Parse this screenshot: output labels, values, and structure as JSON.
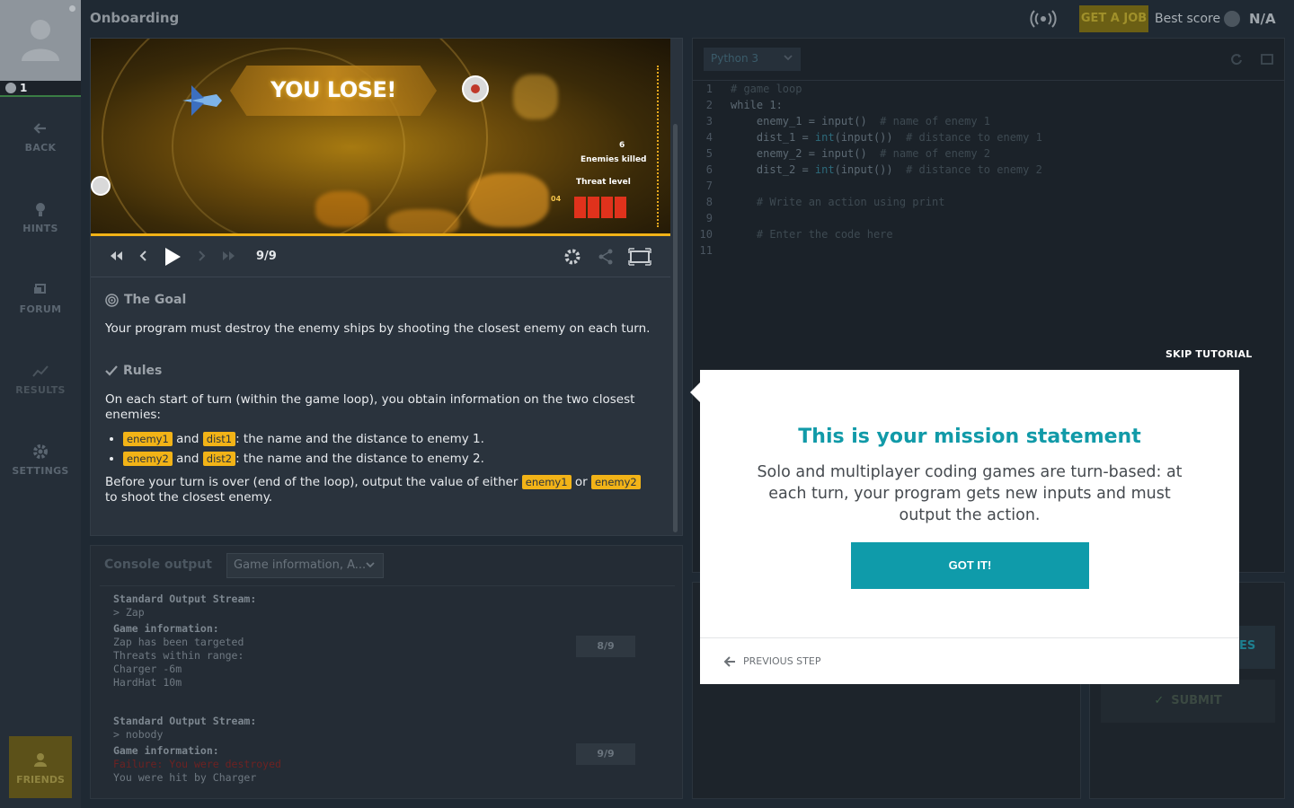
{
  "sidebar": {
    "level": "1",
    "items": [
      {
        "label": "BACK",
        "icon": "arrow-left-icon"
      },
      {
        "label": "HINTS",
        "icon": "lightbulb-icon"
      },
      {
        "label": "FORUM",
        "icon": "forum-icon"
      },
      {
        "label": "RESULTS",
        "icon": "chart-line-icon"
      },
      {
        "label": "SETTINGS",
        "icon": "gear-icon"
      }
    ],
    "friends_label": "FRIENDS"
  },
  "topbar": {
    "title": "Onboarding",
    "get_job": "GET A JOB",
    "best_score_label": "Best score",
    "best_score_value": "N/A"
  },
  "viewer": {
    "banner": "YOU LOSE!",
    "enemies_killed_label": "Enemies killed",
    "enemies_killed_value": "6",
    "threat_label": "Threat level",
    "turn_marker": "04",
    "frame": "9/9",
    "progress": 1.0
  },
  "statement": {
    "goal_title": "The Goal",
    "goal_text": "Your program must destroy the enemy ships by shooting the closest enemy on each turn.",
    "rules_title": "Rules",
    "rules_intro": "On each start of turn (within the game loop), you obtain information on the two closest enemies:",
    "rule1": {
      "tag_a": "enemy1",
      "and": "and",
      "tag_b": "dist1",
      "text": ": the name and the distance to enemy 1."
    },
    "rule2": {
      "tag_a": "enemy2",
      "and": "and",
      "tag_b": "dist2",
      "text": ": the name and the distance to enemy 2."
    },
    "outro_a": "Before your turn is over (end of the loop), output the value of either",
    "outro_tag1": "enemy1",
    "outro_or": "or",
    "outro_tag2": "enemy2",
    "outro_b": "to shoot the closest enemy."
  },
  "console": {
    "title": "Console output",
    "filter": "Game information, A...",
    "blocks": [
      {
        "stdout_label": "Standard Output Stream:",
        "stdout": "> Zap",
        "info_label": "Game information:",
        "lines": [
          "Zap has been targeted",
          "Threats within range:",
          "Charger -6m",
          "HardHat 10m"
        ],
        "turn": "8/9"
      },
      {
        "stdout_label": "Standard Output Stream:",
        "stdout": "> nobody",
        "info_label": "Game information:",
        "fail": "Failure: You were destroyed",
        "lines": [
          "You were hit by Charger"
        ],
        "turn": "9/9"
      }
    ]
  },
  "editor": {
    "language": "Python 3",
    "lines": [
      {
        "n": "1",
        "segs": [
          [
            "c-cm",
            "# game loop"
          ]
        ]
      },
      {
        "n": "2",
        "segs": [
          [
            "c-kw",
            "while 1:"
          ]
        ]
      },
      {
        "n": "3",
        "segs": [
          [
            "c-kw",
            "    enemy_1 = input()  "
          ],
          [
            "c-cm",
            "# name of enemy 1"
          ]
        ]
      },
      {
        "n": "4",
        "segs": [
          [
            "c-kw",
            "    dist_1 = "
          ],
          [
            "c-fn",
            "int"
          ],
          [
            "c-kw",
            "(input())  "
          ],
          [
            "c-cm",
            "# distance to enemy 1"
          ]
        ]
      },
      {
        "n": "5",
        "segs": [
          [
            "c-kw",
            "    enemy_2 = input()  "
          ],
          [
            "c-cm",
            "# name of enemy 2"
          ]
        ]
      },
      {
        "n": "6",
        "segs": [
          [
            "c-kw",
            "    dist_2 = "
          ],
          [
            "c-fn",
            "int"
          ],
          [
            "c-kw",
            "(input())  "
          ],
          [
            "c-cm",
            "# distance to enemy 2"
          ]
        ]
      },
      {
        "n": "7",
        "segs": []
      },
      {
        "n": "8",
        "segs": [
          [
            "c-cm",
            "    # Write an action using print"
          ]
        ]
      },
      {
        "n": "9",
        "segs": []
      },
      {
        "n": "10",
        "segs": [
          [
            "c-cm",
            "    # Enter the code here"
          ]
        ]
      },
      {
        "n": "11",
        "segs": []
      }
    ],
    "submit_label": "SUBMIT",
    "peek_text": "ES"
  },
  "modal": {
    "skip": "SKIP TUTORIAL",
    "title": "This is your mission statement",
    "body": "Solo and multiplayer coding games are turn-based: at each turn, your program gets new inputs and must output the action.",
    "button": "GOT IT!",
    "previous": "PREVIOUS STEP"
  },
  "colors": {
    "accent": "#0f9baa",
    "tag": "#f2b317",
    "threat": "#e0321c"
  }
}
